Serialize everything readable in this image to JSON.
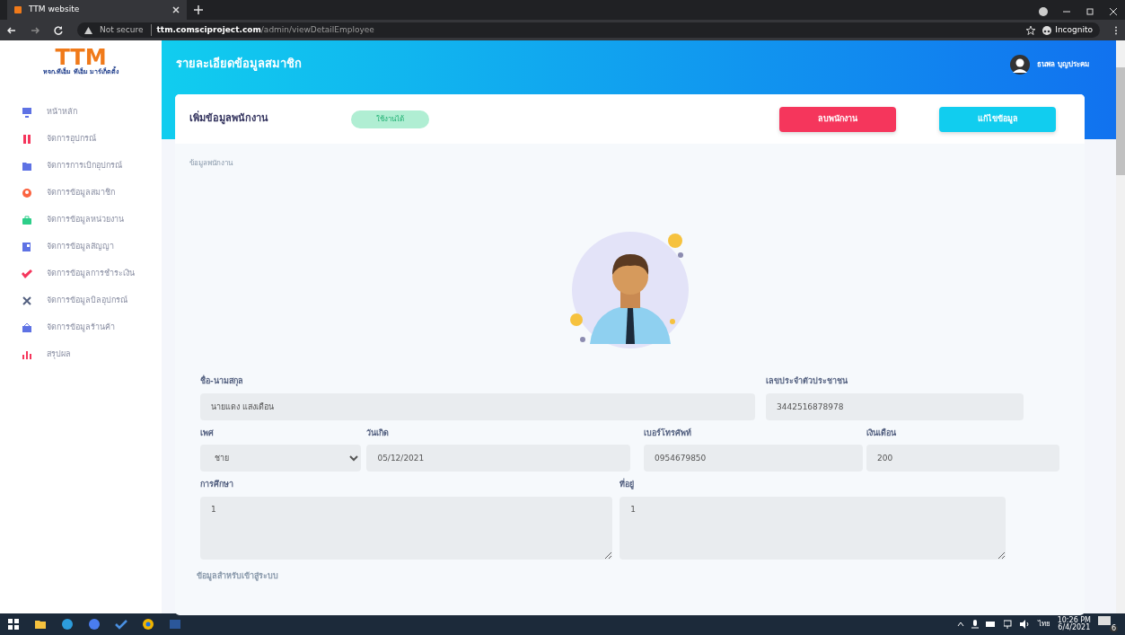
{
  "browser": {
    "tab_title": "TTM website",
    "url_host": "ttm.comsciproject.com",
    "url_path": "/admin/viewDetailEmployee",
    "security": "Not secure",
    "profile": "Incognito"
  },
  "sidebar": {
    "logo": "TTM",
    "logo_subtitle": "หจก.ทีเอ็ม ทีเอ็ม มาร์เก็ตติ้ง",
    "items": [
      {
        "label": "หน้าหลัก",
        "color": "#5e72e4"
      },
      {
        "label": "จัดการอุปกรณ์",
        "color": "#f5365c"
      },
      {
        "label": "จัดการการเบิกอุปกรณ์",
        "color": "#5e72e4"
      },
      {
        "label": "จัดการข้อมูลสมาชิก",
        "color": "#fb6340"
      },
      {
        "label": "จัดการข้อมูลหน่วยงาน",
        "color": "#2dce89"
      },
      {
        "label": "จัดการข้อมูลสัญญา",
        "color": "#5e72e4"
      },
      {
        "label": "จัดการข้อมูลการชำระเงิน",
        "color": "#f5365c"
      },
      {
        "label": "จัดการข้อมูลบิลอุปกรณ์",
        "color": "#525f7f"
      },
      {
        "label": "จัดการข้อมูลร้านค้า",
        "color": "#5e72e4"
      },
      {
        "label": "สรุปผล",
        "color": "#f5365c"
      }
    ]
  },
  "header": {
    "title": "รายละเอียดข้อมูลสมาชิก",
    "user_name": "ธนพล บุญประคม"
  },
  "card": {
    "title": "เพิ่มข้อมูลพนักงาน",
    "status": "ใช้งานได้",
    "buttons": [
      {
        "label": "ลบพนักงาน",
        "kind": "danger"
      },
      {
        "label": "แก้ไขข้อมูล",
        "kind": "info"
      }
    ],
    "section_label": "ข้อมูลพนักงาน",
    "rows": [
      [
        {
          "label": "ชื่อ-นามสกุล",
          "value": "นายแดง แสงเดือน",
          "kind": "input"
        },
        {
          "label": "เลขประจำตัวประชาชน",
          "value": "3442516878978",
          "kind": "input"
        }
      ],
      [
        {
          "label": "เพศ",
          "value": "ชาย",
          "kind": "select"
        },
        {
          "label": "วันเกิด",
          "value": "05/12/2021",
          "kind": "input"
        },
        {
          "label": "เบอร์โทรศัพท์",
          "value": "0954679850",
          "kind": "input"
        },
        {
          "label": "เงินเดือน",
          "value": "200",
          "kind": "input"
        }
      ],
      [
        {
          "label": "การศึกษา",
          "value": "1",
          "kind": "textarea"
        },
        {
          "label": "ที่อยู่",
          "value": "1",
          "kind": "textarea"
        }
      ]
    ],
    "next_section_label": "ข้อมูลสำหรับเข้าสู่ระบบ"
  },
  "taskbar": {
    "language": "ไทย",
    "time": "10:26 PM",
    "date": "6/4/2021",
    "notifications": "6"
  }
}
